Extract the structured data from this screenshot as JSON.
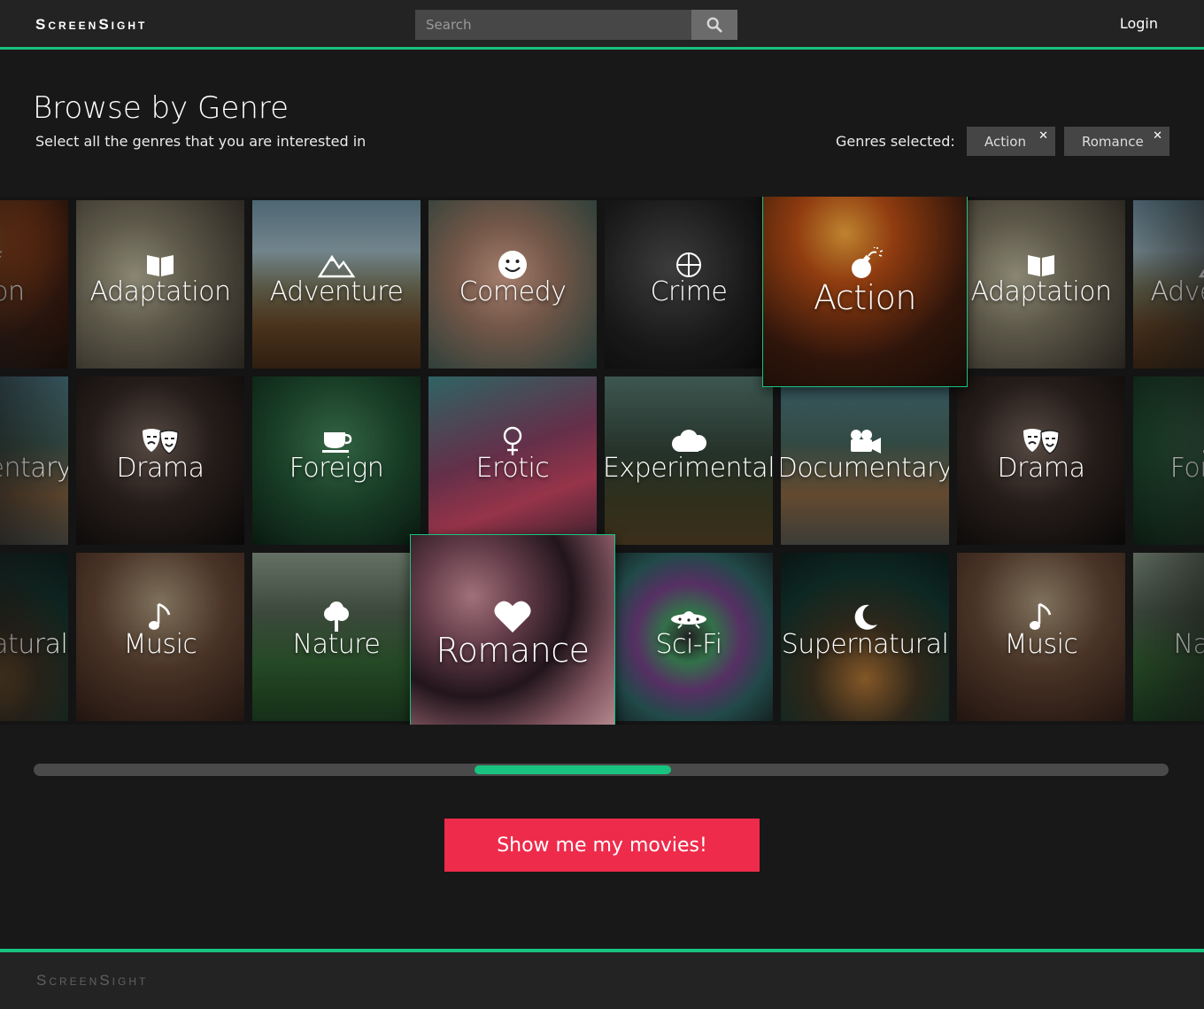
{
  "header": {
    "logo": "ScreenSight",
    "search_placeholder": "Search",
    "login": "Login"
  },
  "page": {
    "title": "Browse by Genre",
    "subtitle": "Select all the genres that you are interested in",
    "selected_label": "Genres selected:"
  },
  "selected_genres": [
    {
      "label": "Action"
    },
    {
      "label": "Romance"
    }
  ],
  "grid": {
    "row1": [
      {
        "label": "Action",
        "icon": "bomb-icon"
      },
      {
        "label": "Adaptation",
        "icon": "book-icon"
      },
      {
        "label": "Adventure",
        "icon": "mountain-icon"
      },
      {
        "label": "Comedy",
        "icon": "smiley-icon"
      },
      {
        "label": "Crime",
        "icon": "crosshair-icon"
      },
      {
        "label": "Action",
        "icon": "bomb-icon",
        "selected": true
      },
      {
        "label": "Adaptation",
        "icon": "book-icon"
      },
      {
        "label": "Adventure",
        "icon": "mountain-icon"
      }
    ],
    "row2": [
      {
        "label": "Documentary",
        "icon": "camera-icon"
      },
      {
        "label": "Drama",
        "icon": "masks-icon"
      },
      {
        "label": "Foreign",
        "icon": "teacup-icon"
      },
      {
        "label": "Erotic",
        "icon": "female-icon"
      },
      {
        "label": "Experimental",
        "icon": "cloud-icon"
      },
      {
        "label": "Documentary",
        "icon": "camera-icon"
      },
      {
        "label": "Drama",
        "icon": "masks-icon"
      },
      {
        "label": "Foreign",
        "icon": "teacup-icon"
      }
    ],
    "row3": [
      {
        "label": "Supernatural",
        "icon": "moon-icon"
      },
      {
        "label": "Music",
        "icon": "music-icon"
      },
      {
        "label": "Nature",
        "icon": "tree-icon"
      },
      {
        "label": "Romance",
        "icon": "heart-icon",
        "selected": true
      },
      {
        "label": "Sci-Fi",
        "icon": "ufo-icon"
      },
      {
        "label": "Supernatural",
        "icon": "moon-icon"
      },
      {
        "label": "Music",
        "icon": "music-icon"
      },
      {
        "label": "Nature",
        "icon": "tree-icon"
      }
    ]
  },
  "scroll": {
    "position": 0.47
  },
  "cta": "Show me my movies!",
  "footer": {
    "logo": "ScreenSight"
  },
  "colors": {
    "accent": "#18c37f",
    "cta": "#ee2b4b",
    "background": "#181818"
  }
}
